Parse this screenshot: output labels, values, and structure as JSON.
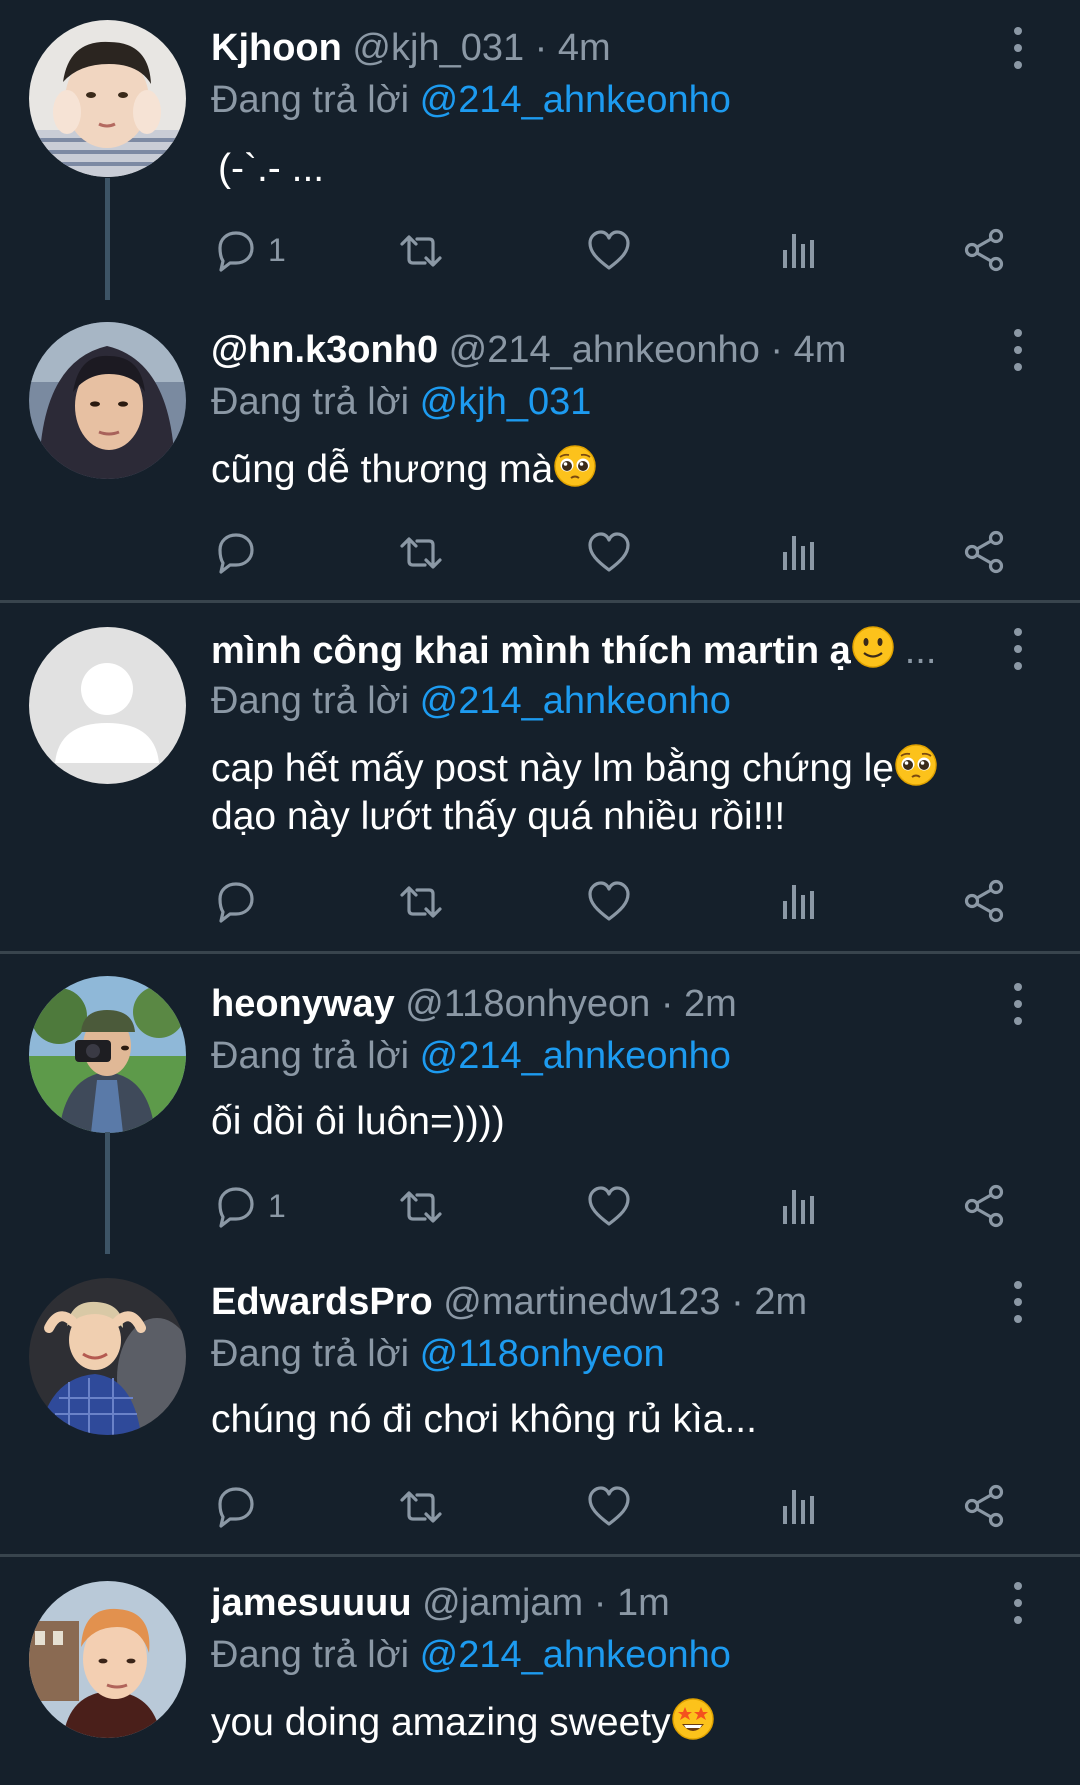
{
  "reply_prefix": "Đang trả lời",
  "colors": {
    "background": "#15202b",
    "muted": "#8b98a5",
    "mention": "#1d9bf0",
    "divider": "#38444d"
  },
  "tweets": [
    {
      "name": "Kjhoon",
      "handle": "@kjh_031",
      "time": "4m",
      "reply_to": "@214_ahnkeonho",
      "text": "(-`.- ...",
      "reply_count": "1"
    },
    {
      "name": "@hn.k3onh0",
      "handle": "@214_ahnkeonho",
      "time": "4m",
      "reply_to": "@kjh_031",
      "text": "cũng dễ thương mà",
      "emoji": "pleading-face-emoji",
      "reply_count": ""
    },
    {
      "name": "mình công khai mình thích martin ạ",
      "name_emoji": "slightly-smiling-face-emoji",
      "name_overflow": "...",
      "reply_to": "@214_ahnkeonho",
      "text_line1": "cap hết mấy post này lm bằng chứng lẹ",
      "text_line2": "dạo này lướt thấy quá nhiều rồi!!!",
      "emoji": "pleading-face-emoji",
      "reply_count": ""
    },
    {
      "name": "heonyway",
      "handle": "@118onhyeon",
      "time": "2m",
      "reply_to": "@214_ahnkeonho",
      "text": "ối dồi ôi luôn=))))",
      "reply_count": "1"
    },
    {
      "name": "EdwardsPro",
      "handle": "@martinedw123",
      "time": "2m",
      "reply_to": "@118onhyeon",
      "text": "chúng nó đi chơi không rủ kìa...",
      "reply_count": ""
    },
    {
      "name": "jamesuuuu",
      "handle": "@jamjam",
      "time": "1m",
      "reply_to": "@214_ahnkeonho",
      "text": "you doing amazing sweety",
      "emoji": "star-struck-emoji"
    }
  ]
}
